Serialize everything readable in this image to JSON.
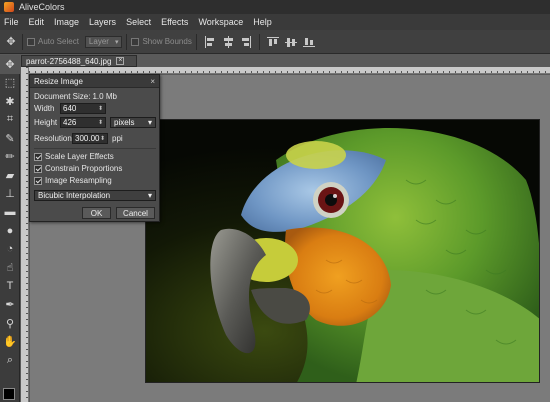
{
  "app": {
    "title": "AliveColors"
  },
  "menu": [
    "File",
    "Edit",
    "Image",
    "Layers",
    "Select",
    "Effects",
    "Workspace",
    "Help"
  ],
  "options_bar": {
    "auto_select_label": "Auto Select",
    "layer_combo_value": "Layer",
    "show_bounds_label": "Show Bounds"
  },
  "document": {
    "tab_title": "parrot-2756488_640.jpg",
    "close_glyph": "×"
  },
  "resize_dialog": {
    "title": "Resize Image",
    "close_glyph": "×",
    "doc_size_label": "Document Size:",
    "doc_size_value": "1.0 Mb",
    "width_label": "Width",
    "width_value": "640",
    "height_label": "Height",
    "height_value": "426",
    "unit_value": "pixels",
    "resolution_label": "Resolution",
    "resolution_value": "300.00",
    "resolution_unit": "ppi",
    "scale_layer_effects_label": "Scale Layer Effects",
    "constrain_proportions_label": "Constrain Proportions",
    "image_resampling_label": "Image Resampling",
    "interpolation_value": "Bicubic Interpolation",
    "ok_label": "OK",
    "cancel_label": "Cancel"
  },
  "colors": {
    "foreground_swatch": "#000000",
    "dialog_bg": "#4b4b4b",
    "canvas_bg": "#7b7b7b"
  }
}
